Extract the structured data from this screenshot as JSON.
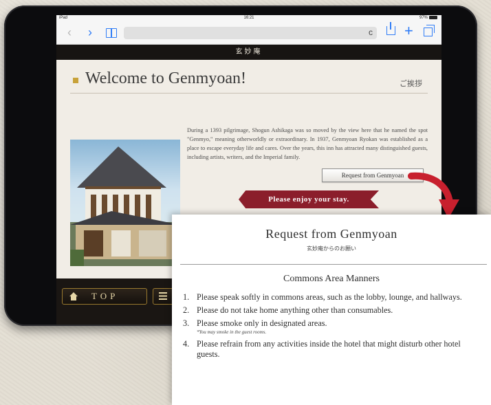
{
  "status_bar": {
    "device": "iPad",
    "time": "16:21",
    "battery": "97%"
  },
  "site": {
    "header_title": "玄妙庵",
    "page_title": "Welcome to Genmyoan!",
    "greeting": "ご挨拶",
    "intro": "During a 1393 pilgrimage, Shogun Ashikaga was so moved by the view here that he named the spot \"Genmyo,\" meaning otherworldly or extraordinary. In 1937, Genmyoan Ryokan was established as a place to escape everyday life and cares. Over the years, this inn has attracted many distinguished guests, including artists, writers, and the Imperial family.",
    "request_button": "Request from Genmyoan",
    "enjoy_banner": "Please enjoy your stay.",
    "nav": {
      "top_label": "TOP"
    }
  },
  "popup": {
    "title": "Request from Genmyoan",
    "subtitle": "玄妙庵からのお願い",
    "section_title": "Commons Area Manners",
    "rules": [
      {
        "num": "1.",
        "text": "Please speak softly in commons areas, such as the lobby, lounge, and hallways."
      },
      {
        "num": "2.",
        "text": "Please do not take home anything other than consumables."
      },
      {
        "num": "3.",
        "text": "Please smoke only in designated areas.",
        "note": "*You may smoke in the guest rooms."
      },
      {
        "num": "4.",
        "text": "Please refrain from any activities inside the hotel that might disturb other hotel guests."
      }
    ]
  },
  "colors": {
    "banner": "#8b1e2b",
    "arrow": "#c8202e",
    "ios_blue": "#2f7cf6",
    "accent_gold": "#c8a23a"
  }
}
